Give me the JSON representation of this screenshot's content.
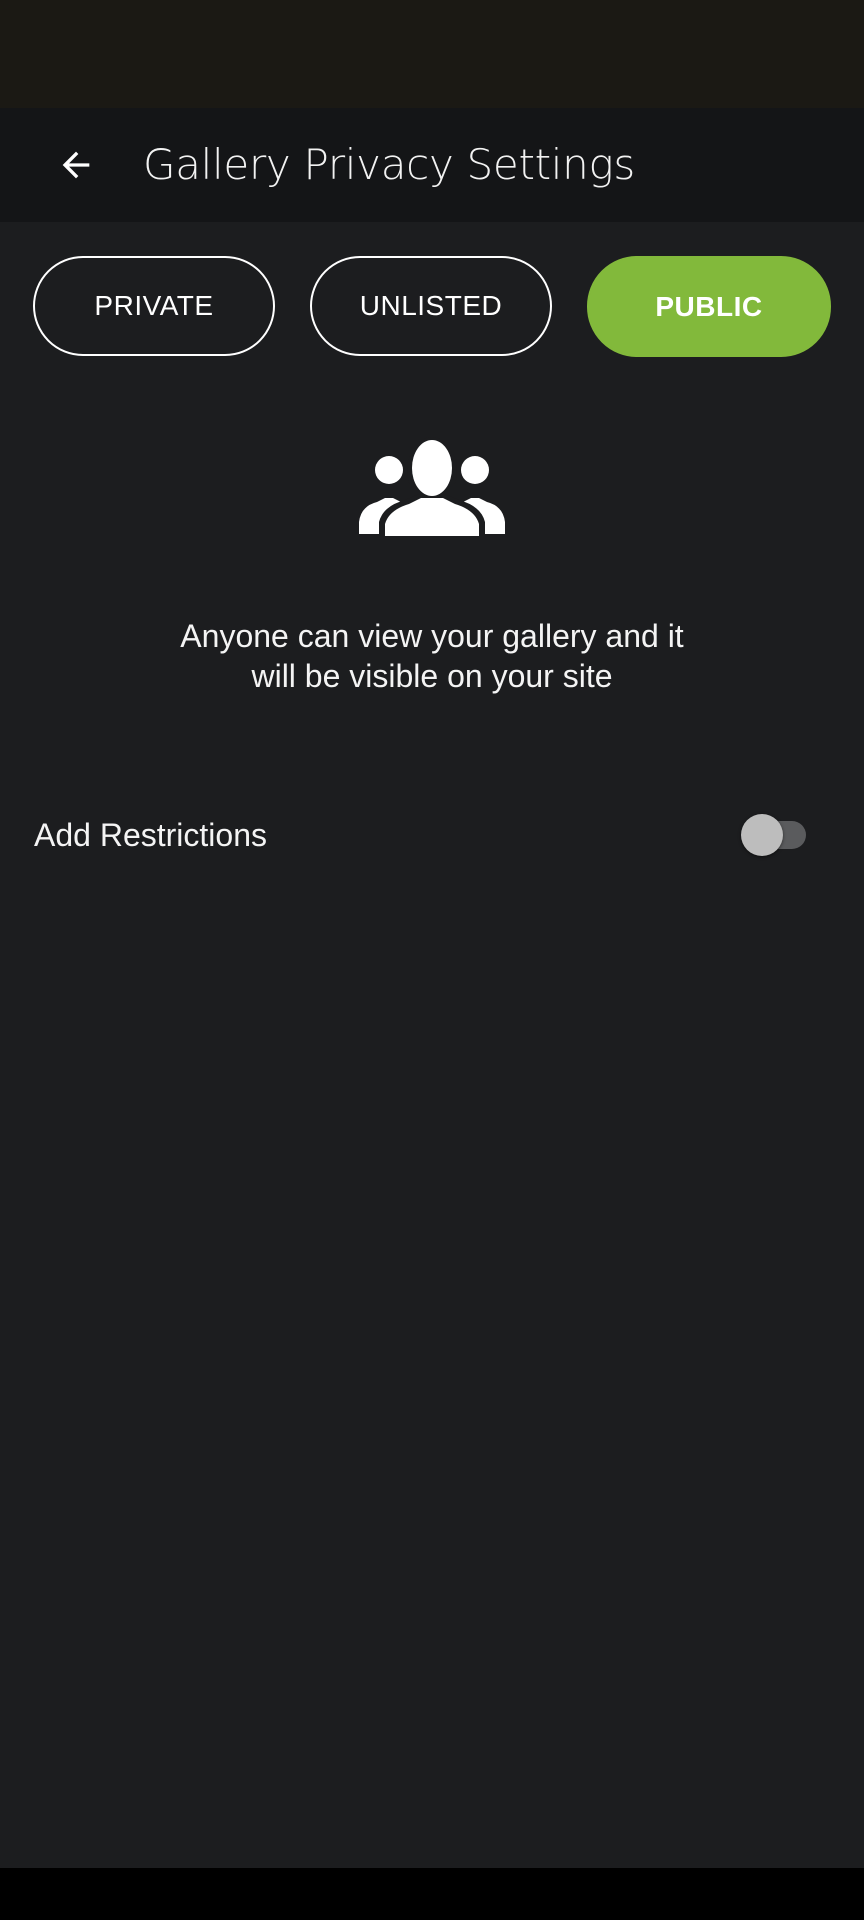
{
  "app_bar": {
    "title": "Gallery Privacy Settings",
    "back_icon": "arrow-left-icon"
  },
  "privacy_options": {
    "private_label": "PRIVATE",
    "unlisted_label": "UNLISTED",
    "public_label": "PUBLIC",
    "selected": "PUBLIC"
  },
  "main": {
    "icon": "people-group-icon",
    "description_line1": "Anyone can view your gallery and it",
    "description_line2": "will be visible on your site"
  },
  "restrictions": {
    "label": "Add Restrictions",
    "enabled": false
  },
  "colors": {
    "accent": "#82b93b",
    "background": "#1c1d1f",
    "app_bar": "#141517",
    "status_bar": "#1b1914"
  }
}
